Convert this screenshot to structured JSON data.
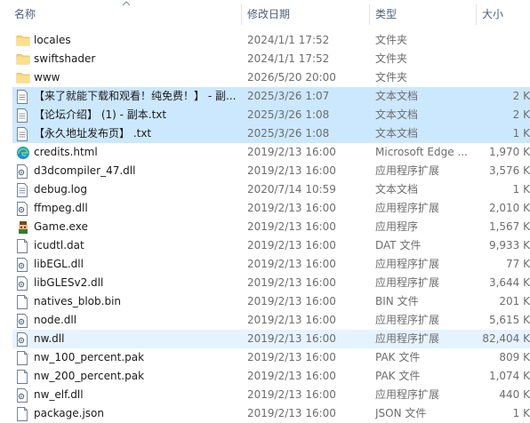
{
  "columns": {
    "name": "名称",
    "date": "修改日期",
    "type": "类型",
    "size": "大小"
  },
  "files": [
    {
      "name": "locales",
      "date": "2024/1/1 17:52",
      "type": "文件夹",
      "size": "",
      "icon": "folder-icon"
    },
    {
      "name": "swiftshader",
      "date": "2024/1/1 17:52",
      "type": "文件夹",
      "size": "",
      "icon": "folder-icon"
    },
    {
      "name": "www",
      "date": "2026/5/20 20:00",
      "type": "文件夹",
      "size": "",
      "icon": "folder-icon"
    },
    {
      "name": "【来了就能下载和观看！纯免费！】 - 副...",
      "date": "2025/3/26 1:07",
      "type": "文本文档",
      "size": "2 K",
      "icon": "text-document-icon",
      "selected": true
    },
    {
      "name": "【论坛介绍】 (1) - 副本.txt",
      "date": "2025/3/26 1:08",
      "type": "文本文档",
      "size": "2 K",
      "icon": "text-document-icon",
      "selected": true
    },
    {
      "name": "【永久地址发布页】 .txt",
      "date": "2025/3/26 1:08",
      "type": "文本文档",
      "size": "1 K",
      "icon": "text-document-icon",
      "selected": true
    },
    {
      "name": "credits.html",
      "date": "2019/2/13 16:00",
      "type": "Microsoft Edge ...",
      "size": "1,970 K",
      "icon": "edge-icon"
    },
    {
      "name": "d3dcompiler_47.dll",
      "date": "2019/2/13 16:00",
      "type": "应用程序扩展",
      "size": "3,576 K",
      "icon": "dll-icon"
    },
    {
      "name": "debug.log",
      "date": "2020/7/14 10:59",
      "type": "文本文档",
      "size": "1 K",
      "icon": "text-document-icon"
    },
    {
      "name": "ffmpeg.dll",
      "date": "2019/2/13 16:00",
      "type": "应用程序扩展",
      "size": "2,010 K",
      "icon": "dll-icon"
    },
    {
      "name": "Game.exe",
      "date": "2019/2/13 16:00",
      "type": "应用程序",
      "size": "1,567 K",
      "icon": "game-exe-icon"
    },
    {
      "name": "icudtl.dat",
      "date": "2019/2/13 16:00",
      "type": "DAT 文件",
      "size": "9,933 K",
      "icon": "file-icon"
    },
    {
      "name": "libEGL.dll",
      "date": "2019/2/13 16:00",
      "type": "应用程序扩展",
      "size": "77 K",
      "icon": "dll-icon"
    },
    {
      "name": "libGLESv2.dll",
      "date": "2019/2/13 16:00",
      "type": "应用程序扩展",
      "size": "3,644 K",
      "icon": "dll-icon"
    },
    {
      "name": "natives_blob.bin",
      "date": "2019/2/13 16:00",
      "type": "BIN 文件",
      "size": "201 K",
      "icon": "file-icon"
    },
    {
      "name": "node.dll",
      "date": "2019/2/13 16:00",
      "type": "应用程序扩展",
      "size": "5,615 K",
      "icon": "dll-icon"
    },
    {
      "name": "nw.dll",
      "date": "2019/2/13 16:00",
      "type": "应用程序扩展",
      "size": "82,404 K",
      "icon": "dll-icon",
      "hover": true
    },
    {
      "name": "nw_100_percent.pak",
      "date": "2019/2/13 16:00",
      "type": "PAK 文件",
      "size": "809 K",
      "icon": "file-icon"
    },
    {
      "name": "nw_200_percent.pak",
      "date": "2019/2/13 16:00",
      "type": "PAK 文件",
      "size": "1,074 K",
      "icon": "file-icon"
    },
    {
      "name": "nw_elf.dll",
      "date": "2019/2/13 16:00",
      "type": "应用程序扩展",
      "size": "440 K",
      "icon": "dll-icon"
    },
    {
      "name": "package.json",
      "date": "2019/2/13 16:00",
      "type": "JSON 文件",
      "size": "1 K",
      "icon": "file-icon"
    }
  ]
}
